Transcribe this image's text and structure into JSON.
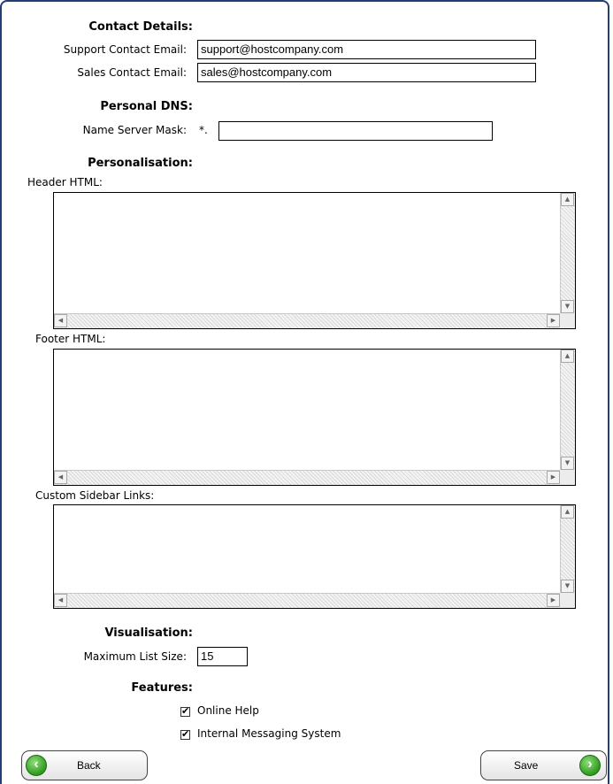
{
  "contact": {
    "heading": "Contact Details:",
    "support_label": "Support Contact Email:",
    "support_value": "support@hostcompany.com",
    "sales_label": "Sales Contact Email:",
    "sales_value": "sales@hostcompany.com"
  },
  "dns": {
    "heading": "Personal DNS:",
    "mask_label": "Name Server Mask:",
    "mask_prefix": "*.",
    "mask_value": ""
  },
  "personalisation": {
    "heading": "Personalisation:",
    "header_label": "Header HTML:",
    "footer_label": "Footer HTML:",
    "sidebar_label": "Custom Sidebar Links:"
  },
  "visualisation": {
    "heading": "Visualisation:",
    "max_list_label": "Maximum List Size:",
    "max_list_value": "15"
  },
  "features": {
    "heading": "Features:",
    "items": [
      {
        "label": "Online Help",
        "checked": true
      },
      {
        "label": "Internal Messaging System",
        "checked": true
      }
    ]
  },
  "buttons": {
    "back_label": "Back",
    "save_label": "Save"
  },
  "icons": {
    "back": "arrow-left-icon",
    "save": "arrow-right-icon"
  }
}
